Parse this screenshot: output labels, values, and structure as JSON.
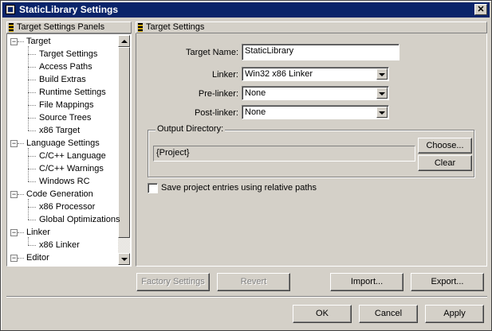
{
  "window": {
    "title": "StaticLibrary Settings",
    "close_glyph": "✕"
  },
  "left_panel": {
    "header": "Target Settings Panels",
    "tree": [
      {
        "label": "Target",
        "level": 0,
        "expanded": true
      },
      {
        "label": "Target Settings",
        "level": 1
      },
      {
        "label": "Access Paths",
        "level": 1
      },
      {
        "label": "Build Extras",
        "level": 1
      },
      {
        "label": "Runtime Settings",
        "level": 1
      },
      {
        "label": "File Mappings",
        "level": 1
      },
      {
        "label": "Source Trees",
        "level": 1
      },
      {
        "label": "x86 Target",
        "level": 1
      },
      {
        "label": "Language Settings",
        "level": 0,
        "expanded": true
      },
      {
        "label": "C/C++ Language",
        "level": 1
      },
      {
        "label": "C/C++ Warnings",
        "level": 1
      },
      {
        "label": "Windows RC",
        "level": 1
      },
      {
        "label": "Code Generation",
        "level": 0,
        "expanded": true
      },
      {
        "label": "x86 Processor",
        "level": 1
      },
      {
        "label": "Global Optimizations",
        "level": 1
      },
      {
        "label": "Linker",
        "level": 0,
        "expanded": true
      },
      {
        "label": "x86 Linker",
        "level": 1
      },
      {
        "label": "Editor",
        "level": 0,
        "expanded": true
      }
    ]
  },
  "right_panel": {
    "header": "Target Settings",
    "target_name_label": "Target Name:",
    "target_name_value": "StaticLibrary",
    "linker_label": "Linker:",
    "linker_value": "Win32 x86 Linker",
    "prelinker_label": "Pre-linker:",
    "prelinker_value": "None",
    "postlinker_label": "Post-linker:",
    "postlinker_value": "None",
    "output_dir_title": "Output Directory:",
    "output_dir_value": "{Project}",
    "choose_label": "Choose...",
    "clear_label": "Clear",
    "checkbox_label": "Save project entries using relative paths",
    "checkbox_checked": false
  },
  "buttons": {
    "factory_settings": "Factory Settings",
    "revert": "Revert",
    "import": "Import...",
    "export": "Export...",
    "ok": "OK",
    "cancel": "Cancel",
    "apply": "Apply"
  }
}
